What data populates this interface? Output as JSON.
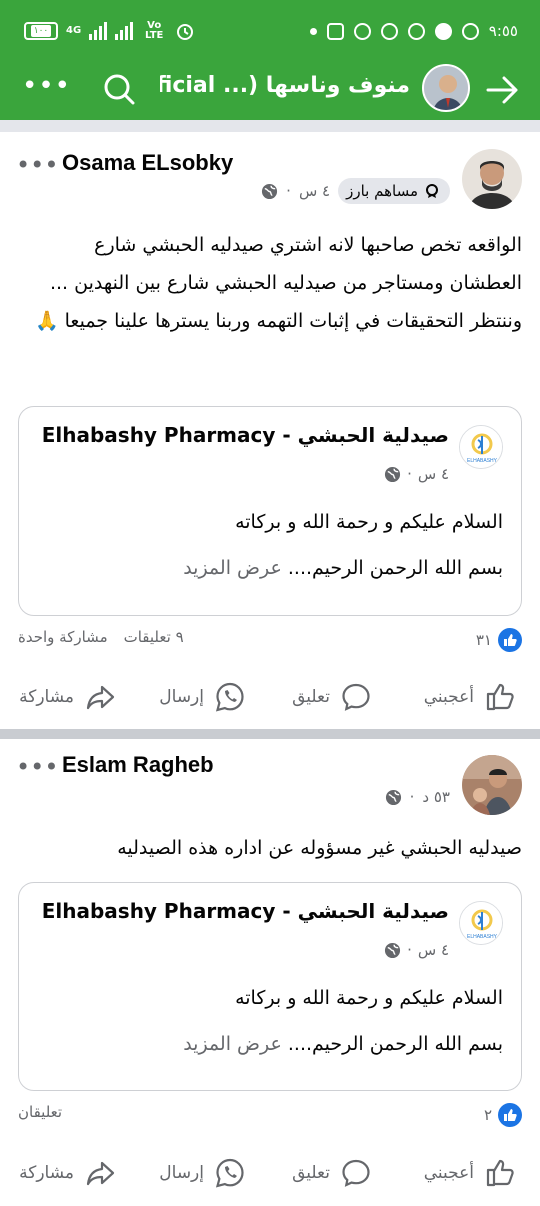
{
  "status_bar": {
    "battery": "١٠٠",
    "network": "4G",
    "volte": "Vo LTE",
    "time": "٩:٥٥"
  },
  "app_bar": {
    "title": "منوف وناسها (... official",
    "back_icon": "arrow-right-icon",
    "search_icon": "search-icon",
    "more_label": "•••"
  },
  "colors": {
    "brand_green": "#3aa53c",
    "like_blue": "#1b74e4",
    "meta_gray": "#65676b"
  },
  "posts": [
    {
      "author": "Osama ELsobky",
      "badge": "مساهم بارز",
      "time": "٤ س",
      "text": "الواقعه تخص صاحبها لانه اشتري صيدليه الحبشي شارع العطشان ومستاجر من صيدليه الحبشي شارع بين النهدين ... وننتظر التحقيقات في إثبات التهمه وربنا يسترها علينا جميعا 🙏",
      "shared": {
        "page_name": "صيدلية الحبشي - Elhabashy Pharmacy",
        "time": "٤ س",
        "line1": "السلام عليكم و رحمة الله و بركاته",
        "line2": "بسم الله الرحمن الرحيم....",
        "see_more": "عرض المزيد"
      },
      "reactions": "٣١",
      "comments": "٩ تعليقات",
      "shares": "مشاركة واحدة",
      "actions": {
        "like": "أعجبني",
        "comment": "تعليق",
        "send": "إرسال",
        "share": "مشاركة"
      }
    },
    {
      "author": "Eslam Ragheb",
      "time": "٥٣ د",
      "text": "صيدليه الحبشي غير مسؤوله عن اداره هذه الصيدليه",
      "shared": {
        "page_name": "صيدلية الحبشي - Elhabashy Pharmacy",
        "time": "٤ س",
        "line1": "السلام عليكم و رحمة الله و بركاته",
        "line2": "بسم الله الرحمن الرحيم....",
        "see_more": "عرض المزيد"
      },
      "reactions": "٢",
      "comments": "تعليقان",
      "actions": {
        "like": "أعجبني",
        "comment": "تعليق",
        "send": "إرسال",
        "share": "مشاركة"
      }
    }
  ]
}
